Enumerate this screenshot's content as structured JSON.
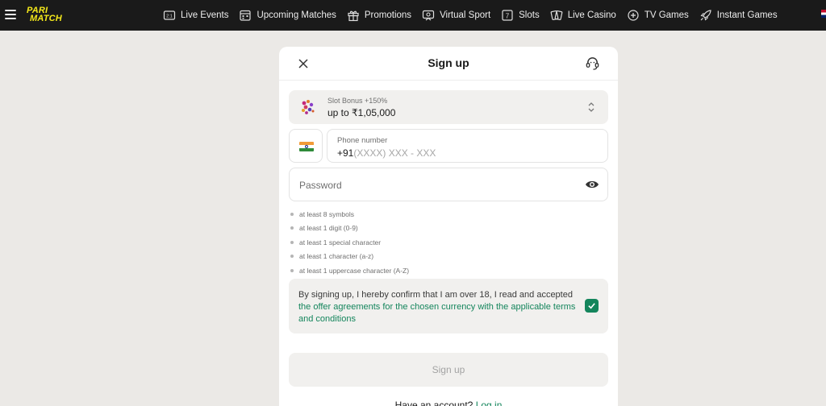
{
  "brand": {
    "logo_line1": "PARI",
    "logo_line2": "MATCH",
    "accent": "#f6ea1a"
  },
  "nav": {
    "items": [
      {
        "label": "Live Events",
        "icon": "live-events-icon"
      },
      {
        "label": "Upcoming Matches",
        "icon": "calendar-icon"
      },
      {
        "label": "Promotions",
        "icon": "gift-icon"
      },
      {
        "label": "Virtual Sport",
        "icon": "virtual-sport-icon"
      },
      {
        "label": "Slots",
        "icon": "slot-icon"
      },
      {
        "label": "Live Casino",
        "icon": "cards-icon"
      },
      {
        "label": "TV Games",
        "icon": "tv-games-icon"
      },
      {
        "label": "Instant Games",
        "icon": "rocket-icon"
      }
    ]
  },
  "modal": {
    "title": "Sign up",
    "bonus": {
      "title": "Slot Bonus +150%",
      "value": "up to ₹1,05,000"
    },
    "phone": {
      "label": "Phone number",
      "code": "+91",
      "placeholder": "(XXXX) XXX - XXX"
    },
    "password": {
      "placeholder": "Password"
    },
    "rules": [
      "at least 8 symbols",
      "at least 1 digit (0-9)",
      "at least 1 special character",
      "at least 1 character (a-z)",
      "at least 1 uppercase character (A-Z)"
    ],
    "consent": {
      "text": "By signing up, I hereby confirm that I am over 18, I read and accepted ",
      "link": "the offer agreements for the chosen currency with the applicable terms and conditions",
      "checked": true
    },
    "submit_label": "Sign up",
    "footer": {
      "text": "Have an account? ",
      "link": "Log in"
    }
  },
  "colors": {
    "green": "#14855c",
    "nav_bg": "#1a1a1a",
    "page_bg": "#ebe9e6"
  }
}
